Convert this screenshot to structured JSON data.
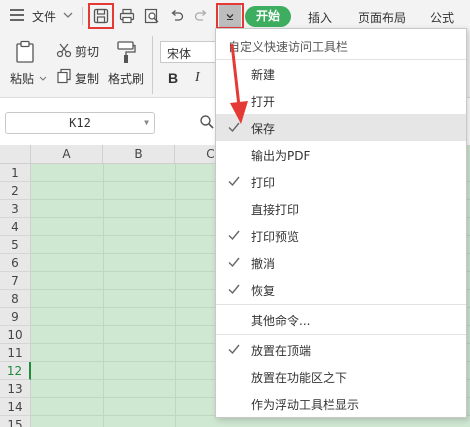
{
  "toolbar": {
    "file_label": "文件",
    "tabs": [
      "开始",
      "插入",
      "页面布局",
      "公式"
    ]
  },
  "ribbon": {
    "paste_label": "粘贴",
    "cut_label": "剪切",
    "copy_label": "复制",
    "format_painter_label": "格式刷",
    "font_name": "宋体",
    "bold": "B",
    "italic": "I"
  },
  "name_box": {
    "value": "K12"
  },
  "sheet": {
    "columns": [
      "A",
      "B",
      "C"
    ],
    "rows": [
      "1",
      "2",
      "3",
      "4",
      "5",
      "6",
      "7",
      "8",
      "9",
      "10",
      "11",
      "12",
      "13",
      "14",
      "15"
    ],
    "active_row": "12"
  },
  "menu": {
    "header": "自定义快速访问工具栏",
    "items": [
      {
        "label": "新建",
        "checked": false
      },
      {
        "label": "打开",
        "checked": false
      },
      {
        "label": "保存",
        "checked": true,
        "highlighted": true
      },
      {
        "label": "输出为PDF",
        "checked": false
      },
      {
        "label": "打印",
        "checked": true
      },
      {
        "label": "直接打印",
        "checked": false
      },
      {
        "label": "打印预览",
        "checked": true
      },
      {
        "label": "撤消",
        "checked": true
      },
      {
        "label": "恢复",
        "checked": true
      },
      {
        "label": "其他命令...",
        "checked": false
      },
      {
        "label": "放置在顶端",
        "checked": true
      },
      {
        "label": "放置在功能区之下",
        "checked": false
      },
      {
        "label": "作为浮动工具栏显示",
        "checked": false
      }
    ]
  },
  "colors": {
    "accent_green": "#3dae5f",
    "highlight_red": "#e53935",
    "sheet_green": "#cfe8d2"
  }
}
